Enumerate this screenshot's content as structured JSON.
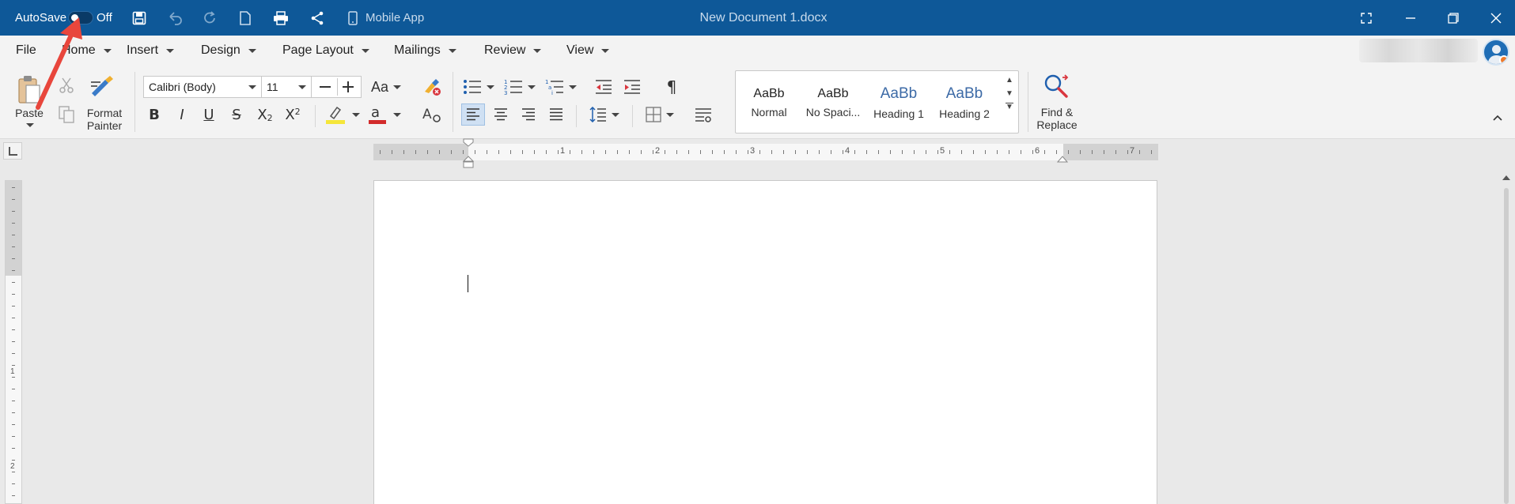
{
  "titlebar": {
    "autosave_label": "AutoSave",
    "autosave_state": "Off",
    "mobile_app": "Mobile App",
    "doc_title": "New Document 1.docx"
  },
  "menu": {
    "items": [
      "File",
      "Home",
      "Insert",
      "Design",
      "Page Layout",
      "Mailings",
      "Review",
      "View"
    ]
  },
  "ribbon": {
    "paste_label": "Paste",
    "format_painter_label": [
      "Format",
      "Painter"
    ],
    "font_name": "Calibri (Body)",
    "font_size": "11",
    "change_case_label": "Aa",
    "styles": [
      {
        "sample": "AaBb",
        "name": "Normal"
      },
      {
        "sample": "AaBb",
        "name": "No Spaci..."
      },
      {
        "sample": "AaBb",
        "name": "Heading 1"
      },
      {
        "sample": "AaBb",
        "name": "Heading 2"
      }
    ],
    "find_replace_label": [
      "Find &",
      "Replace"
    ]
  },
  "ruler": {
    "horizontal_numbers": [
      "1",
      "2",
      "3",
      "4",
      "5",
      "6",
      "7"
    ],
    "vertical_numbers": [
      "1",
      "2"
    ]
  },
  "colors": {
    "titlebar": "#0e5898",
    "annotation_arrow": "#e8463c",
    "highlight": "#f5e63a",
    "font_color": "#d22b2b"
  }
}
